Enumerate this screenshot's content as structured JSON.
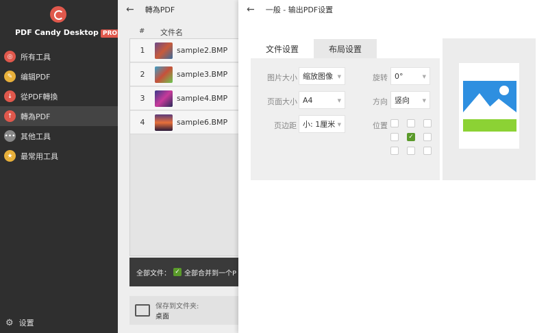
{
  "sidebar": {
    "app_name": "PDF Candy Desktop",
    "pro_badge": "PRO",
    "items": [
      {
        "label": "所有工具",
        "icon": "tools-icon",
        "color": "#e0584c"
      },
      {
        "label": "编辑PDF",
        "icon": "edit-icon",
        "color": "#e8b03a"
      },
      {
        "label": "從PDF轉換",
        "icon": "download-icon",
        "color": "#e0584c"
      },
      {
        "label": "轉為PDF",
        "icon": "upload-icon",
        "color": "#e0584c"
      },
      {
        "label": "其他工具",
        "icon": "more-icon",
        "color": "#888888"
      },
      {
        "label": "最常用工具",
        "icon": "star-icon",
        "color": "#e8b03a"
      }
    ],
    "active_index": 3,
    "settings_label": "设置"
  },
  "middle": {
    "title": "轉為PDF",
    "col_hash": "#",
    "col_filename": "文件名",
    "files": [
      {
        "num": "1",
        "name": "sample2.BMP"
      },
      {
        "num": "2",
        "name": "sample3.BMP"
      },
      {
        "num": "3",
        "name": "sample4.BMP"
      },
      {
        "num": "4",
        "name": "sample6.BMP"
      }
    ],
    "all_files_label": "全部文件：",
    "merge_label": "全部合并到一个P",
    "save_to_label": "保存到文件夹:",
    "save_path": "桌面"
  },
  "settings": {
    "title": "一般 - 输出PDF设置",
    "tabs": [
      "文件设置",
      "布局设置"
    ],
    "active_tab": 1,
    "image_size_label": "图片大小",
    "image_size_value": "缩放图像",
    "page_size_label": "页面大小",
    "page_size_value": "A4",
    "margin_label": "页边距",
    "margin_value": "小: 1厘米",
    "rotate_label": "旋转",
    "rotate_value": "0°",
    "orientation_label": "方向",
    "orientation_value": "竖向",
    "position_label": "位置",
    "selected_position": "center"
  },
  "colors": {
    "accent_green": "#5a9a2a",
    "brand_red": "#e0584c",
    "preview_blue": "#2e8fe0",
    "preview_green": "#8cd234"
  }
}
